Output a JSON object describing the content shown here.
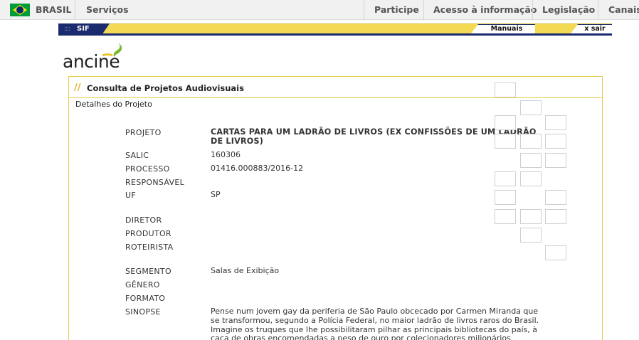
{
  "gov_bar": {
    "country": "BRASIL",
    "items": [
      "Serviços",
      "Participe",
      "Acesso à informação",
      "Legislação",
      "Canais"
    ]
  },
  "sif_bar": {
    "tab_label": "SIF",
    "manuais_label": "Manuais",
    "sair_label": "x sair"
  },
  "logo": {
    "text": "ancine"
  },
  "panel": {
    "title": "Consulta de Projetos Audiovisuais",
    "section": "Detalhes do Projeto"
  },
  "fields": {
    "projeto": {
      "label": "PROJETO",
      "value": "CARTAS PARA UM LADRÃO DE LIVROS (EX CONFISSÕES DE UM LADRÃO DE LIVROS)"
    },
    "salic": {
      "label": "SALIC",
      "value": "160306"
    },
    "processo": {
      "label": "PROCESSO",
      "value": "01416.000883/2016-12"
    },
    "responsavel": {
      "label": "RESPONSÁVEL",
      "value": ""
    },
    "uf": {
      "label": "UF",
      "value": "SP"
    },
    "diretor": {
      "label": "DIRETOR",
      "value": ""
    },
    "produtor": {
      "label": "PRODUTOR",
      "value": ""
    },
    "roteirista": {
      "label": "ROTEIRISTA",
      "value": ""
    },
    "segmento": {
      "label": "SEGMENTO",
      "value": "Salas de Exibição"
    },
    "genero": {
      "label": "GÊNERO",
      "value": ""
    },
    "formato": {
      "label": "FORMATO",
      "value": ""
    },
    "sinopse": {
      "label": "SINOPSE",
      "value": "Pense num jovem gay da periferia de São Paulo obcecado por Carmen Miranda que se transformou, segundo a Polícia Federal, no maior ladrão de livros raros do Brasil. Imagine os truques que lhe possibilitaram pilhar as principais bibliotecas do país, à caça de obras encomendadas a peso de ouro por colecionadores milionários."
    }
  },
  "colors": {
    "accent_yellow": "#f4da54",
    "navy": "#1a2a6e",
    "panel_border": "#e6c94a"
  }
}
